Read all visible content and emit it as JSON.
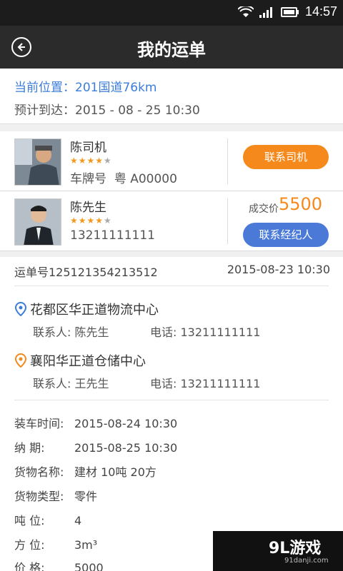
{
  "status_bar": {
    "time": "14:57",
    "icons": [
      "wifi-icon",
      "signal-icon",
      "battery-icon"
    ]
  },
  "header": {
    "title": "我的运单"
  },
  "arrival": {
    "location_label": "当前位置：",
    "location_value": "201国道76km",
    "eta_label": "预计到达：",
    "eta_value": "2015 - 08 - 25  10:30"
  },
  "driver": {
    "name": "陈司机",
    "stars": 4,
    "plate_label": "车牌号",
    "plate_value": "粤 A00000",
    "button": "联系司机"
  },
  "agent": {
    "name": "陈先生",
    "stars": 4,
    "phone": "13211111111",
    "price_label": "成交价",
    "price_value": "5500",
    "button": "联系经纪人"
  },
  "order": {
    "number": "运单号125121354213512",
    "date": "2015-08-23 10:30",
    "origin": {
      "name": "花都区华正道物流中心",
      "contact": "联系人:  陈先生",
      "phone": "电话: 13211111111"
    },
    "destination": {
      "name": "襄阳华正道仓储中心",
      "contact": "联系人:  王先生",
      "phone": "电话: 13211111111"
    },
    "details": [
      {
        "label": "装车时间:",
        "value": "2015-08-24 10:30"
      },
      {
        "label": "纳      期:",
        "value": "2015-08-25 10:30"
      },
      {
        "label": "货物名称:",
        "value": "建材    10吨     20方"
      },
      {
        "label": "货物类型:",
        "value": "零件"
      },
      {
        "label": "吨      位:",
        "value": "4"
      },
      {
        "label": "方      位:",
        "value": "3m³"
      },
      {
        "label": "价      格:",
        "value": "5000"
      }
    ]
  },
  "watermark": {
    "brand": "9L游戏",
    "url": "91danji.com"
  },
  "colors": {
    "accent_blue": "#4a79d8",
    "accent_orange": "#f5891b",
    "header_bg": "#2b2b2b"
  }
}
